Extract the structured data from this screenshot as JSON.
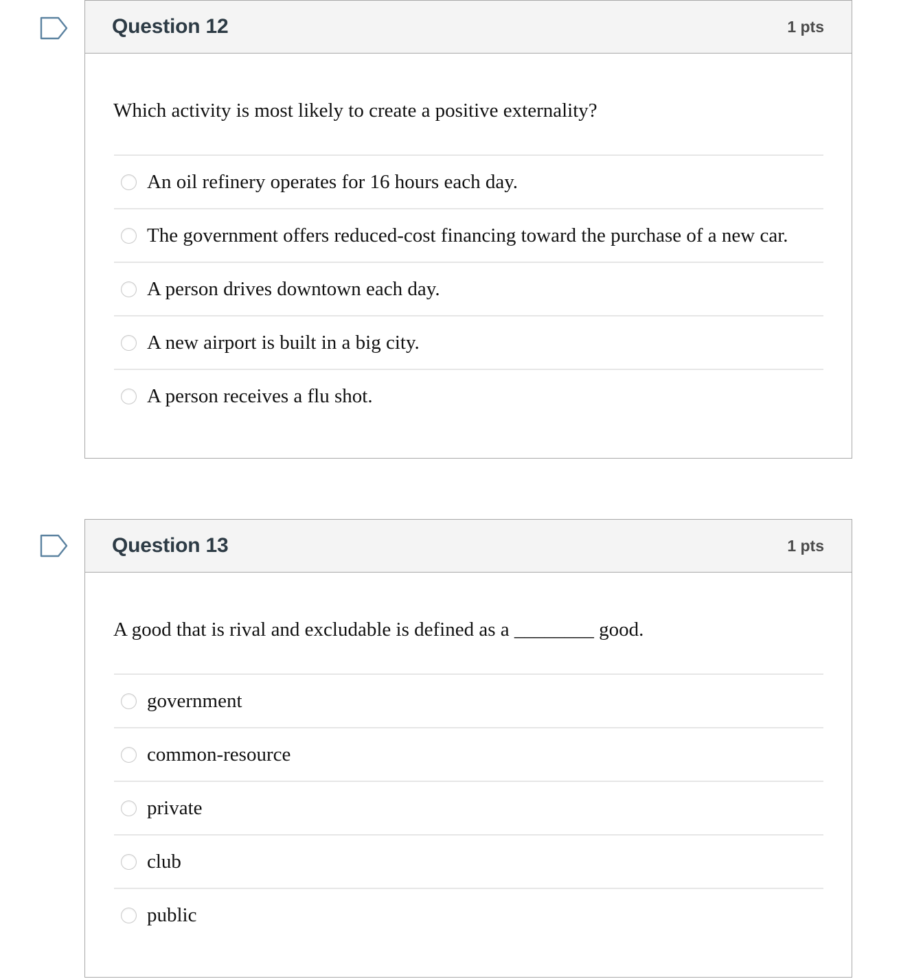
{
  "colors": {
    "header_bg": "#f4f4f4",
    "card_border": "#a8a8a8",
    "title_text": "#2d3b45",
    "points_text": "#4b4b4b",
    "divider": "#e6e6e6",
    "radio_border": "#c9c9c9",
    "flag_outline": "#5b82a0"
  },
  "questions": [
    {
      "flag_icon": "flag-bookmark-icon",
      "title": "Question 12",
      "points": "1 pts",
      "prompt": "Which activity is most likely to create a positive externality?",
      "options": [
        {
          "label": "An oil refinery operates for 16 hours each day.",
          "selected": false
        },
        {
          "label": "The government offers reduced-cost financing toward the purchase of a new car.",
          "selected": false
        },
        {
          "label": "A person drives downtown each day.",
          "selected": false
        },
        {
          "label": "A new airport is built in a big city.",
          "selected": false
        },
        {
          "label": "A person receives a flu shot.",
          "selected": false
        }
      ]
    },
    {
      "flag_icon": "flag-bookmark-icon",
      "title": "Question 13",
      "points": "1 pts",
      "prompt": "A good that is rival and excludable is defined as a ________ good.",
      "options": [
        {
          "label": "government",
          "selected": false
        },
        {
          "label": "common-resource",
          "selected": false
        },
        {
          "label": "private",
          "selected": false
        },
        {
          "label": "club",
          "selected": false
        },
        {
          "label": "public",
          "selected": false
        }
      ]
    }
  ]
}
